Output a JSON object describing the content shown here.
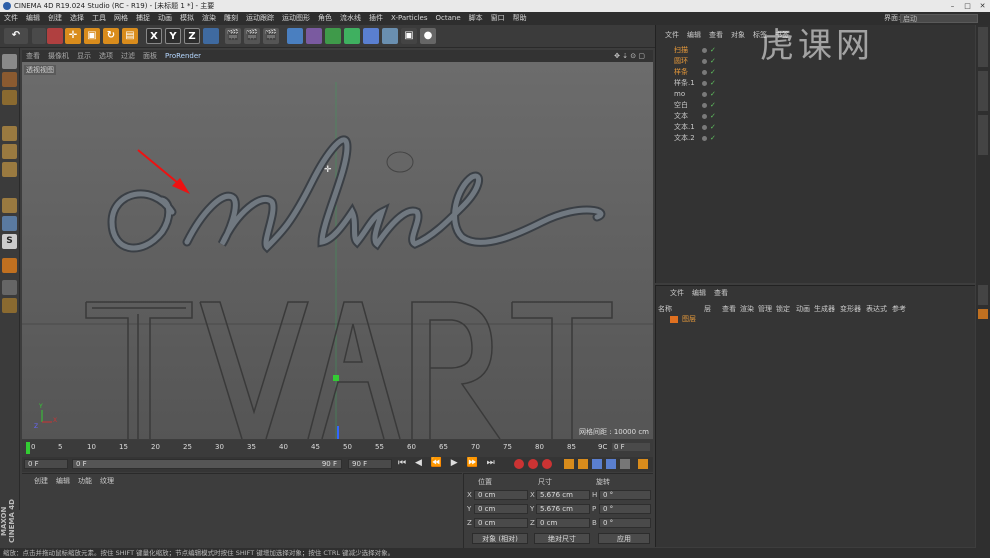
{
  "titlebar": {
    "title": "CINEMA 4D R19.024 Studio (RC - R19) - [未标题 1 *] - 主要",
    "min": "–",
    "max": "□",
    "close": "✕"
  },
  "menu": [
    "文件",
    "编辑",
    "创建",
    "选择",
    "工具",
    "网格",
    "捕捉",
    "动画",
    "模拟",
    "渲染",
    "雕刻",
    "运动跟踪",
    "运动图形",
    "角色",
    "流水线",
    "插件",
    "X-Particles",
    "Octane",
    "脚本",
    "窗口",
    "帮助"
  ],
  "layout": {
    "label": "界面:",
    "value": "启动"
  },
  "toolbar": {
    "undo": "↶",
    "x": "X",
    "y": "Y",
    "z": "Z"
  },
  "viewport": {
    "menu": [
      "查看",
      "摄像机",
      "显示",
      "选项",
      "过滤",
      "面板"
    ],
    "renderer": "ProRender",
    "label": "透视视图",
    "grid": "网格间距 : 10000 cm",
    "script_text": "online",
    "outline_text": "TVART"
  },
  "timeline": {
    "ticks": [
      "0",
      "5",
      "10",
      "15",
      "20",
      "25",
      "30",
      "35",
      "40",
      "45",
      "50",
      "55",
      "60",
      "65",
      "70",
      "75",
      "80",
      "85",
      "9C"
    ],
    "end_frame": "0 F"
  },
  "playback": {
    "start": "0 F",
    "range_start": "0 F",
    "range_end": "90 F",
    "end": "90 F"
  },
  "materials": {
    "menu": [
      "创建",
      "编辑",
      "功能",
      "纹理"
    ]
  },
  "coords": {
    "headers": {
      "pos": "位置",
      "size": "尺寸",
      "rot": "旋转"
    },
    "rows": [
      {
        "axis": "X",
        "pos": "0 cm",
        "saxis": "X",
        "size": "5.676 cm",
        "raxis": "H",
        "rot": "0 °"
      },
      {
        "axis": "Y",
        "pos": "0 cm",
        "saxis": "Y",
        "size": "5.676 cm",
        "raxis": "P",
        "rot": "0 °"
      },
      {
        "axis": "Z",
        "pos": "0 cm",
        "saxis": "Z",
        "size": "0 cm",
        "raxis": "B",
        "rot": "0 °"
      }
    ],
    "mode1": "对象 (相对)",
    "mode2": "绝对尺寸",
    "apply": "应用"
  },
  "objects": {
    "menu": [
      "文件",
      "编辑",
      "查看",
      "对象",
      "标签",
      "书签"
    ],
    "rows": [
      {
        "name": "扫描",
        "color": "#e89a3a"
      },
      {
        "name": "圆环",
        "color": "#e89a3a"
      },
      {
        "name": "样条",
        "color": "#e89a3a"
      },
      {
        "name": "样条.1",
        "color": "#c8c8c8"
      },
      {
        "name": "mo",
        "color": "#c8c8c8"
      },
      {
        "name": "空白",
        "color": "#c8c8c8"
      },
      {
        "name": "文本",
        "color": "#c8c8c8"
      },
      {
        "name": "文本.1",
        "color": "#c8c8c8"
      },
      {
        "name": "文本.2",
        "color": "#c8c8c8"
      }
    ]
  },
  "attributes": {
    "menu": [
      "文件",
      "编辑",
      "查看"
    ],
    "columns": [
      "名称",
      "层",
      "查看",
      "渲染",
      "管理",
      "锁定",
      "动画",
      "生成器",
      "变形器",
      "表达式",
      "参考"
    ],
    "layer": "图层"
  },
  "status": "缩放：点击并拖动鼠标缩放元素。按住 SHIFT 键量化缩放；节点编辑模式时按住 SHIFT 键增加选择对象；按住 CTRL 键减少选择对象。",
  "brand": {
    "maxon": "MAXON",
    "c4d": "CINEMA 4D"
  },
  "watermark": "虎课网"
}
